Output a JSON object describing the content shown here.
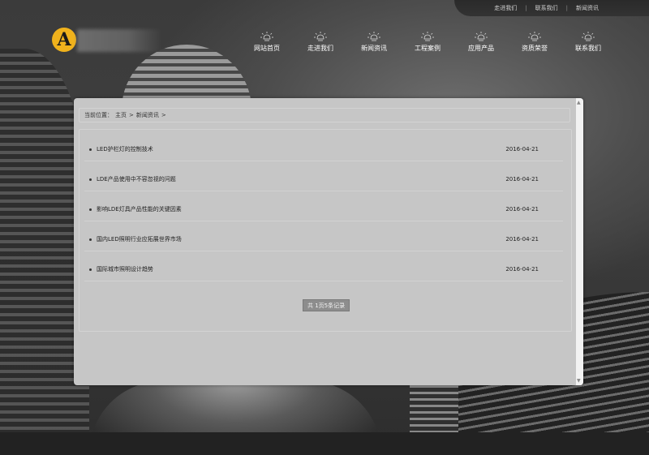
{
  "top_links": [
    "走进我们",
    "联系我们",
    "新闻资讯"
  ],
  "top_links_separator": "|",
  "logo": {
    "letter": "A"
  },
  "nav": [
    {
      "label": "网站首页"
    },
    {
      "label": "走进我们"
    },
    {
      "label": "新闻资讯"
    },
    {
      "label": "工程案例"
    },
    {
      "label": "应用产品"
    },
    {
      "label": "资质荣誉"
    },
    {
      "label": "联系我们"
    }
  ],
  "breadcrumb": {
    "prefix": "当前位置：",
    "items": [
      "主页",
      "新闻资讯"
    ],
    "separator": ">"
  },
  "news": [
    {
      "title": "LED护栏灯的控制技术",
      "date": "2016-04-21"
    },
    {
      "title": "LDE产品使用中不容忽视的问题",
      "date": "2016-04-21"
    },
    {
      "title": "影响LDE灯具产品性能的关键因素",
      "date": "2016-04-21"
    },
    {
      "title": "国内LED照明行业应拓展世界市场",
      "date": "2016-04-21"
    },
    {
      "title": "国际城市照明设计趋势",
      "date": "2016-04-21"
    }
  ],
  "pager": {
    "text": "共 1页5条记录"
  },
  "colors": {
    "logo_accent": "#f0b21c",
    "panel_bg": "#c6c6c6",
    "pager_bg": "#8d8d8d"
  },
  "icons": {
    "nav": "light-bulb-icon",
    "scroll_up": "arrow-up-icon",
    "scroll_down": "arrow-down-icon"
  }
}
